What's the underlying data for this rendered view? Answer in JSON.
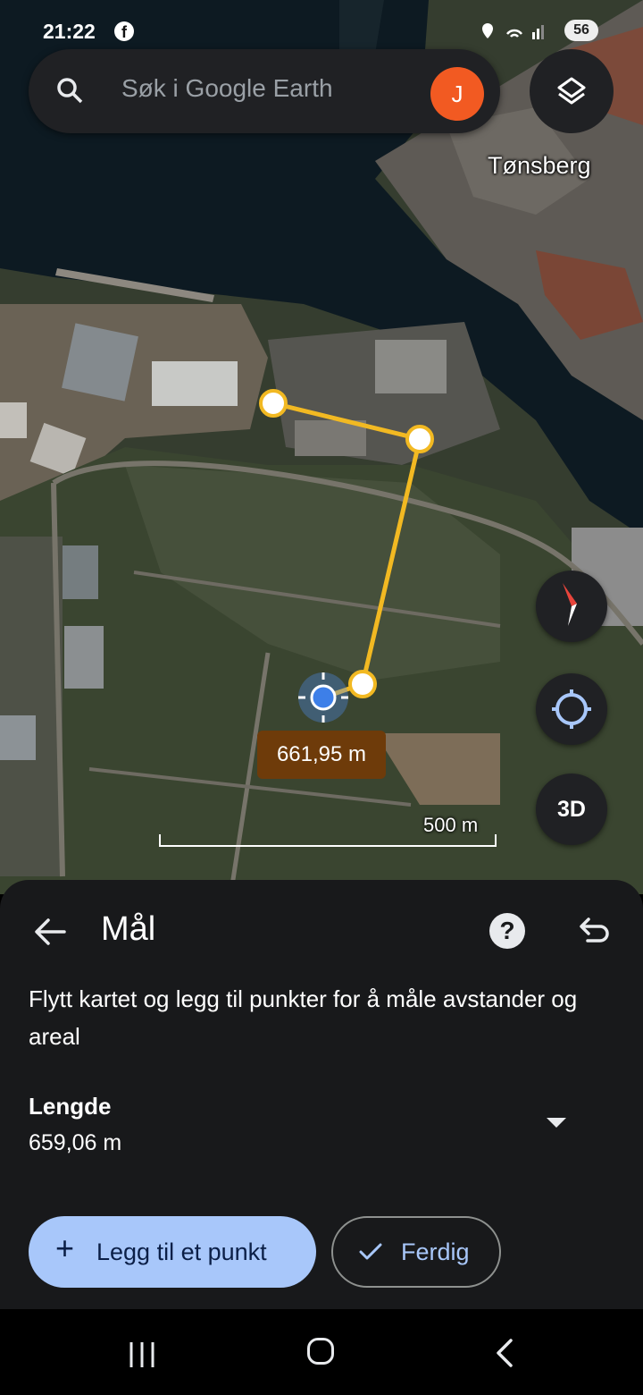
{
  "status_bar": {
    "time": "21:22",
    "notification_icon": "facebook-icon",
    "battery": "56"
  },
  "search": {
    "placeholder": "Søk i Google Earth",
    "avatar_initial": "J"
  },
  "map": {
    "place_label": "Tønsberg",
    "distance_label": "661,95 m",
    "scale_label": "500 m",
    "button_3d": "3D",
    "colors": {
      "measure_line": "#f2b922",
      "location_dot": "#3d7fe8"
    }
  },
  "sheet": {
    "title": "Mål",
    "description": "Flytt kartet og legg til punkter for å måle avstander og areal",
    "length_label": "Lengde",
    "length_value": "659,06 m",
    "add_point_button": "Legg til et punkt",
    "done_button": "Ferdig",
    "colors": {
      "primary_button": "#a8c7fa"
    }
  }
}
